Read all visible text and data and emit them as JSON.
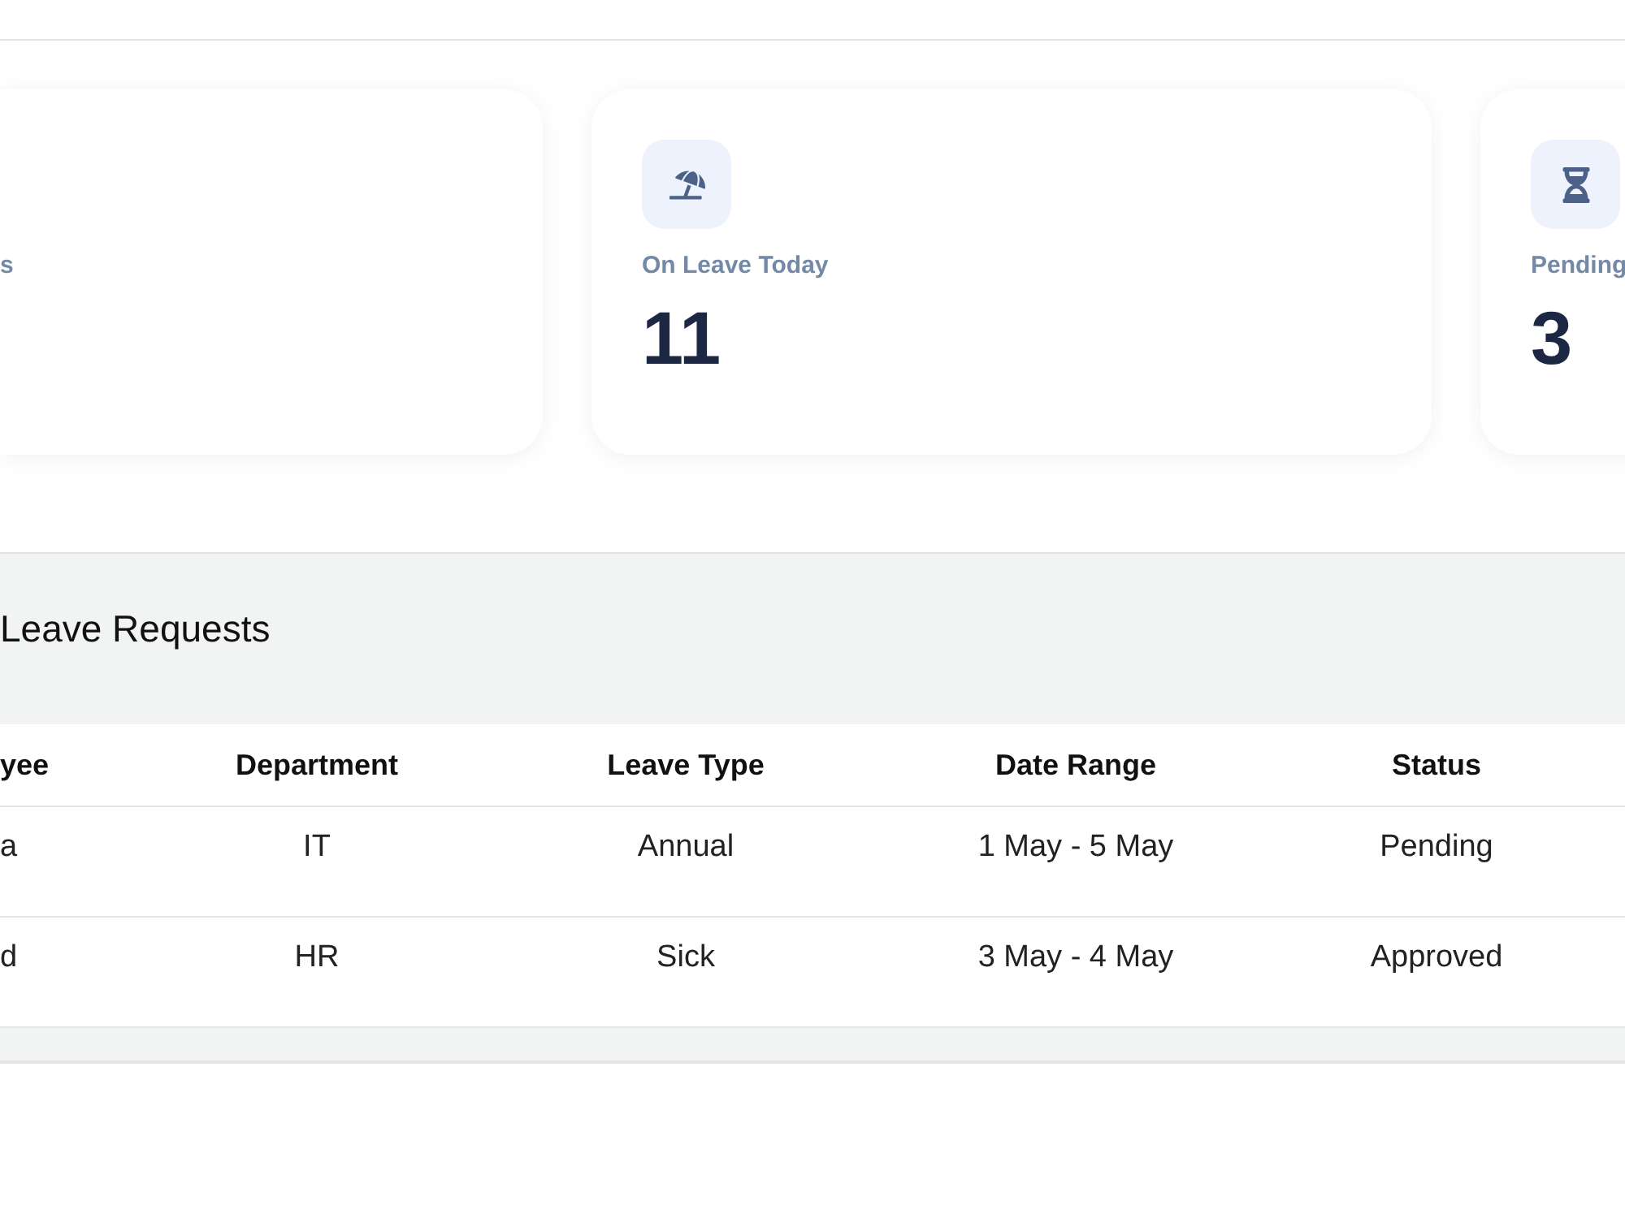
{
  "cards": [
    {
      "label": "s"
    },
    {
      "label": "On Leave Today",
      "value": "11"
    },
    {
      "label": "Pending",
      "value": "3"
    }
  ],
  "table": {
    "title": "Leave Requests",
    "columns": [
      "yee",
      "Department",
      "Leave Type",
      "Date Range",
      "Status"
    ],
    "rows": [
      [
        "a",
        "IT",
        "Annual",
        "1 May - 5 May",
        "Pending"
      ],
      [
        "d",
        "HR",
        "Sick",
        "3 May - 4 May",
        "Approved"
      ]
    ]
  }
}
